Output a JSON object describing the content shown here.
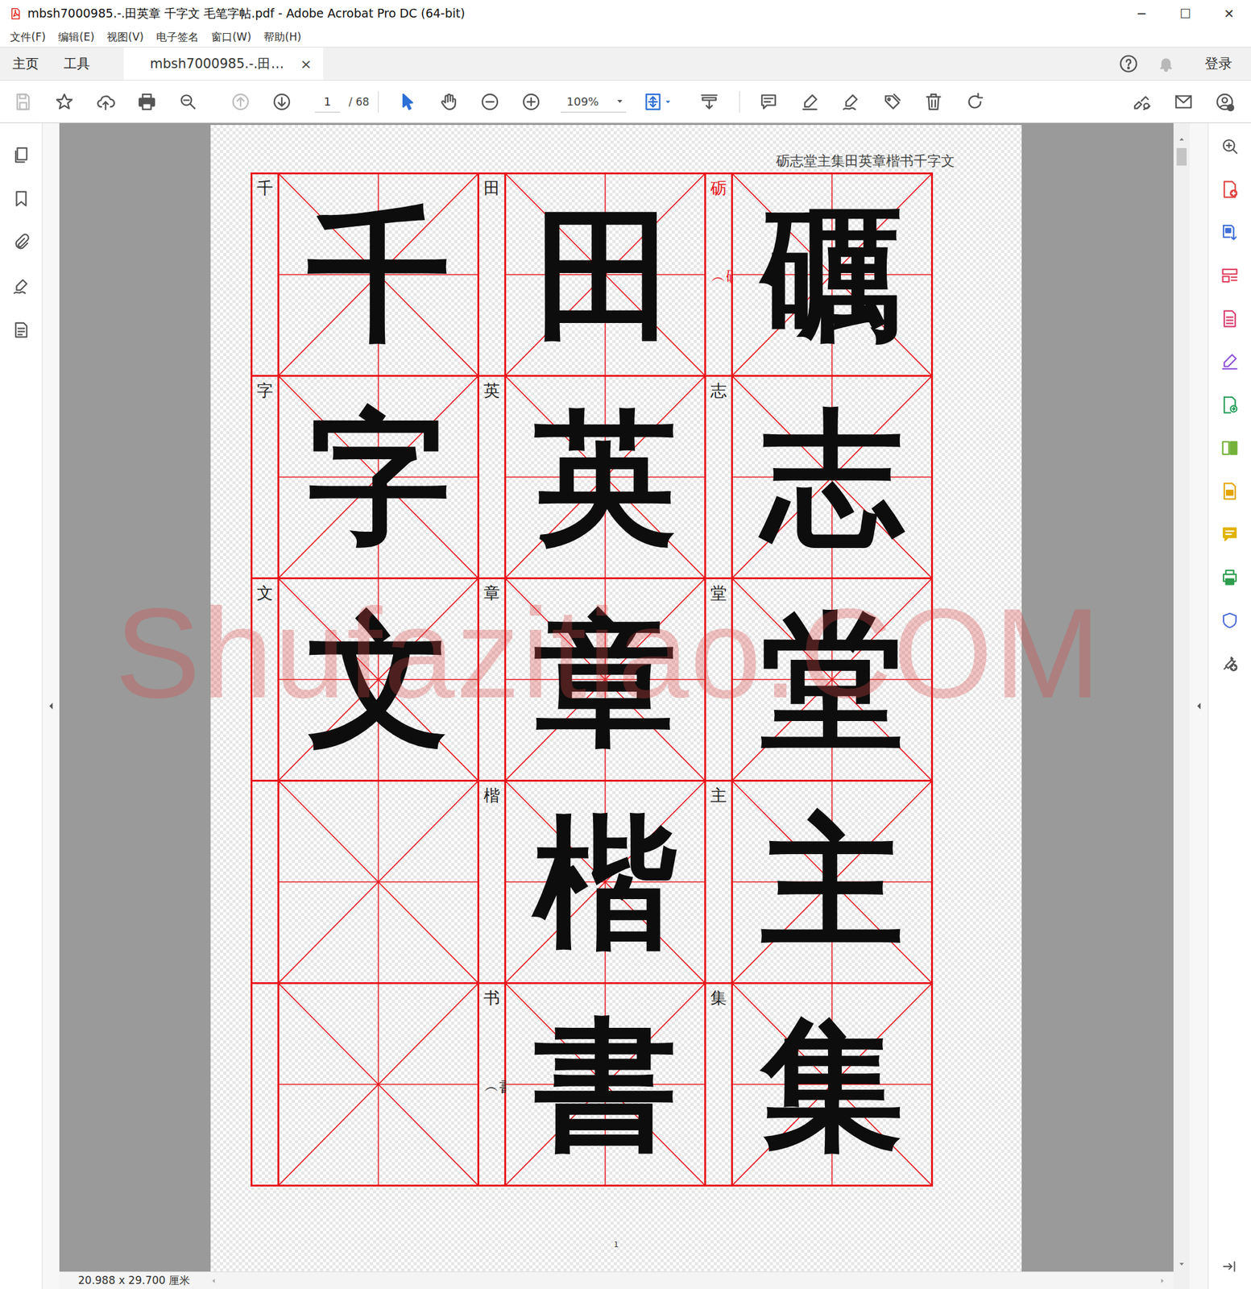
{
  "window": {
    "title": "mbsh7000985.-.田英章 千字文 毛笔字帖.pdf - Adobe Acrobat Pro DC (64-bit)",
    "controls": [
      "─",
      "☐",
      "✕"
    ]
  },
  "menu": [
    "文件(F)",
    "编辑(E)",
    "视图(V)",
    "电子签名",
    "窗口(W)",
    "帮助(H)"
  ],
  "tabs": [
    {
      "label": "主页",
      "selected": false
    },
    {
      "label": "工具",
      "selected": false
    },
    {
      "label": "mbsh7000985.-.田…",
      "selected": true,
      "close": "×"
    }
  ],
  "account": {
    "login": "登录"
  },
  "toolbar": {
    "save_disabled": true,
    "previous_page_disabled": true,
    "page_current": "1",
    "page_total": "/ 68",
    "zoom": "109%"
  },
  "document": {
    "header": "砺志堂主集田英章楷书千字文",
    "watermark": "Shufazitiao.COM",
    "page_number": "1",
    "columns": [
      {
        "cells": [
          {
            "label": "砺",
            "variant": "︵礪︶",
            "char": "礪",
            "color": "#e8141b"
          },
          {
            "label": "志",
            "variant": "",
            "char": "志",
            "color": "#222222"
          },
          {
            "label": "堂",
            "variant": "",
            "char": "堂",
            "color": "#222222"
          },
          {
            "label": "主",
            "variant": "",
            "char": "主",
            "color": "#222222"
          },
          {
            "label": "集",
            "variant": "",
            "char": "集",
            "color": "#222222"
          }
        ]
      },
      {
        "cells": [
          {
            "label": "田",
            "variant": "",
            "char": "田",
            "color": "#222222"
          },
          {
            "label": "英",
            "variant": "",
            "char": "英",
            "color": "#222222"
          },
          {
            "label": "章",
            "variant": "",
            "char": "章",
            "color": "#222222"
          },
          {
            "label": "楷",
            "variant": "",
            "char": "楷",
            "color": "#222222"
          },
          {
            "label": "书",
            "variant": "︵書︶",
            "char": "書",
            "color": "#222222"
          }
        ]
      },
      {
        "cells": [
          {
            "label": "千",
            "variant": "",
            "char": "千",
            "color": "#222222"
          },
          {
            "label": "字",
            "variant": "",
            "char": "字",
            "color": "#222222"
          },
          {
            "label": "文",
            "variant": "",
            "char": "文",
            "color": "#222222"
          }
        ]
      }
    ]
  },
  "status_bar": {
    "page_size": "20.988 x 29.700 厘米"
  }
}
